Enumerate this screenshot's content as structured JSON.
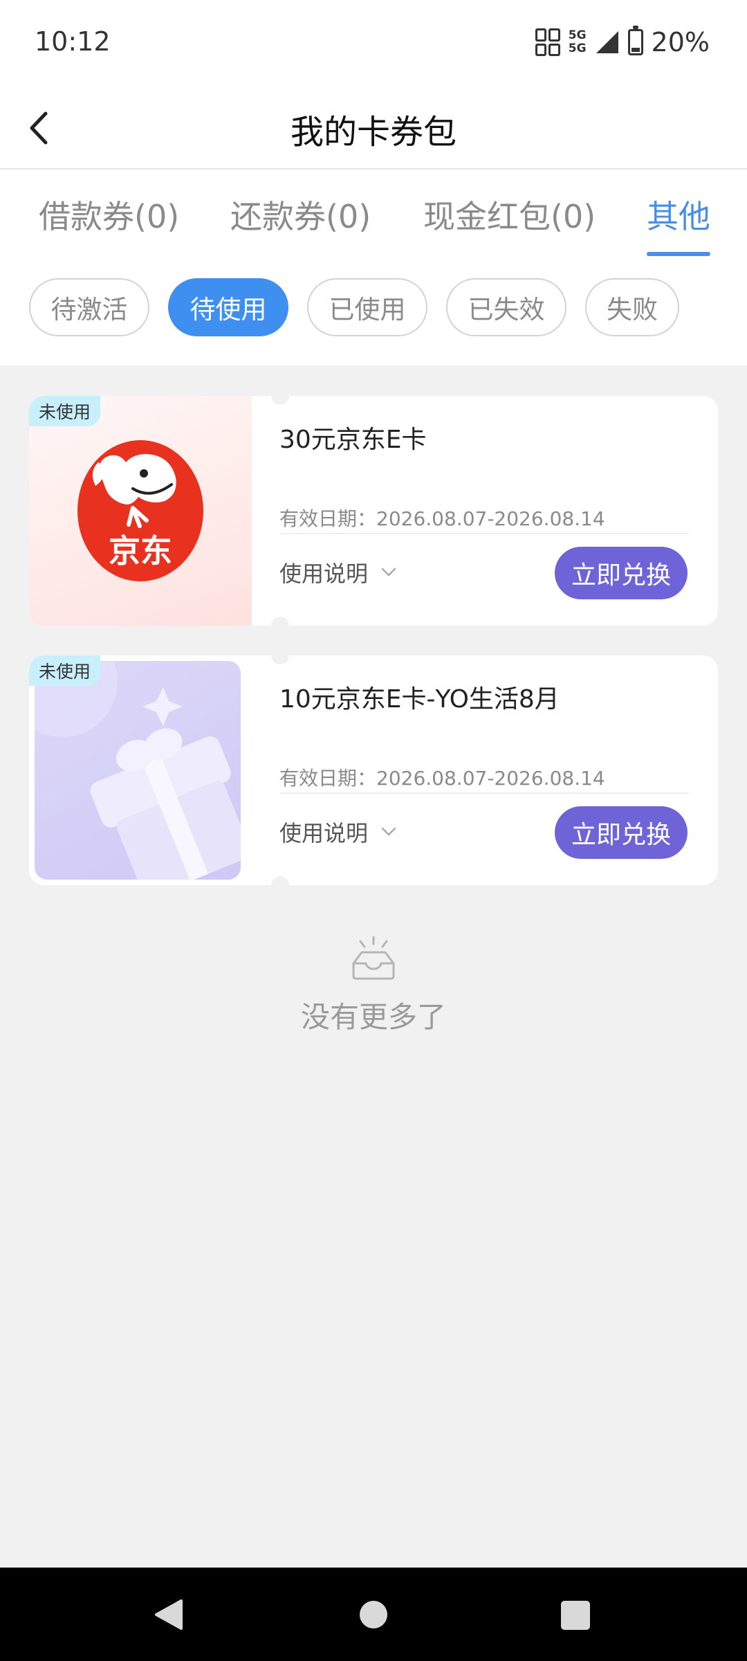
{
  "status_bar": {
    "time": "10:12",
    "network_top": "5G",
    "network_bottom": "5G",
    "battery": "20%"
  },
  "header": {
    "title": "我的卡券包",
    "back_icon": "chevron-left-icon"
  },
  "tabs": [
    {
      "label": "借款券(0)",
      "active": false
    },
    {
      "label": "还款券(0)",
      "active": false
    },
    {
      "label": "现金红包(0)",
      "active": false
    },
    {
      "label": "其他",
      "active": true
    }
  ],
  "filters": [
    {
      "label": "待激活",
      "active": false
    },
    {
      "label": "待使用",
      "active": true
    },
    {
      "label": "已使用",
      "active": false
    },
    {
      "label": "已失效",
      "active": false
    },
    {
      "label": "失败",
      "active": false
    }
  ],
  "coupons": [
    {
      "badge": "未使用",
      "logo_text": "京东",
      "title": "30元京东E卡",
      "validity": "有效日期：2026.08.07-2026.08.14",
      "usage_label": "使用说明",
      "button_label": "立即兑换"
    },
    {
      "badge": "未使用",
      "title": "10元京东E卡-YO生活8月",
      "validity": "有效日期：2026.08.07-2026.08.14",
      "usage_label": "使用说明",
      "button_label": "立即兑换"
    }
  ],
  "end_message": "没有更多了",
  "colors": {
    "accent_blue": "#3f8ff0",
    "tab_active": "#4a8fe5",
    "redeem_button": "#6f63d8",
    "badge_bg": "#c7f0fc",
    "jd_red": "#e8321f"
  }
}
